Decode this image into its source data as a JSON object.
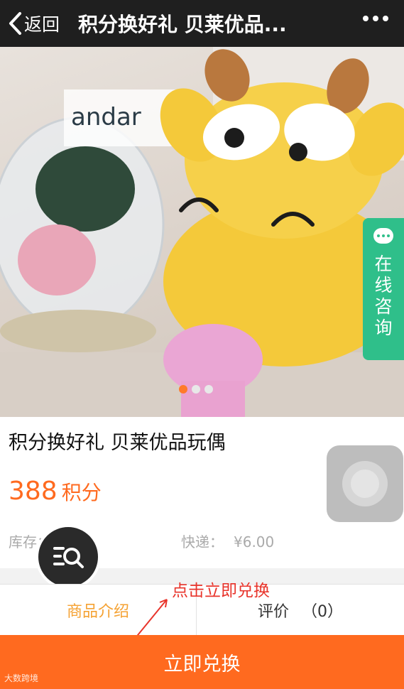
{
  "header": {
    "back_label": "返回",
    "title": "积分换好礼 贝莱优品..."
  },
  "consult": {
    "label_chars": [
      "在",
      "线",
      "咨",
      "询"
    ]
  },
  "product": {
    "name": "积分换好礼 贝莱优品玩偶",
    "price_value": "388",
    "price_unit": "积分",
    "stock_label": "库存：",
    "shipping_label": "快递：",
    "shipping_value": "¥6.00"
  },
  "tabs": {
    "intro": "商品介绍",
    "review_label": "评价",
    "review_count": "（0）"
  },
  "annotation": {
    "text": "点击立即兑换"
  },
  "action": {
    "redeem_label": "立即兑换"
  },
  "watermark": {
    "text": "大数跨境"
  },
  "carousel": {
    "total": 3,
    "active": 1
  },
  "colors": {
    "accent_orange": "#ff6a1f",
    "tab_active": "#f5a233",
    "consult_green": "#2fbf8a",
    "annotation_red": "#e8342b"
  }
}
